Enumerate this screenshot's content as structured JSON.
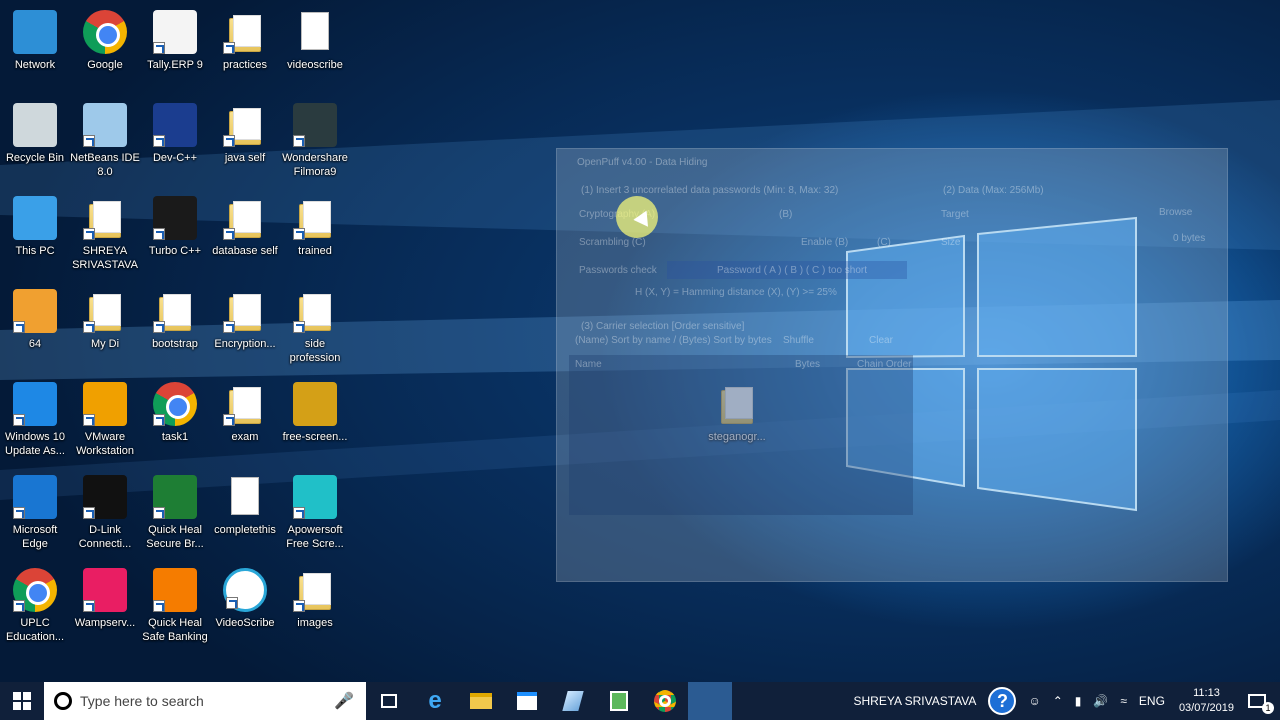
{
  "desktop": {
    "icons": [
      {
        "label": "Network",
        "type": "network"
      },
      {
        "label": "Google",
        "type": "chrome"
      },
      {
        "label": "Tally.ERP 9",
        "type": "tally"
      },
      {
        "label": "practices",
        "type": "folder"
      },
      {
        "label": "videoscribe",
        "type": "doc"
      },
      {
        "label": "Recycle Bin",
        "type": "bin"
      },
      {
        "label": "NetBeans IDE 8.0",
        "type": "netbeans"
      },
      {
        "label": "Dev-C++",
        "type": "devcpp"
      },
      {
        "label": "java self",
        "type": "folder"
      },
      {
        "label": "Wondershare Filmora9",
        "type": "filmora"
      },
      {
        "label": "This PC",
        "type": "pc"
      },
      {
        "label": "SHREYA SRIVASTAVA",
        "type": "folder"
      },
      {
        "label": "Turbo C++",
        "type": "turbo"
      },
      {
        "label": "database self",
        "type": "folder"
      },
      {
        "label": "trained",
        "type": "folder"
      },
      {
        "label": "64",
        "type": "app"
      },
      {
        "label": "My Di",
        "type": "folder"
      },
      {
        "label": "bootstrap",
        "type": "folder"
      },
      {
        "label": "Encryption...",
        "type": "folder"
      },
      {
        "label": "side profession",
        "type": "folder"
      },
      {
        "label": "Windows 10 Update As...",
        "type": "win10"
      },
      {
        "label": "VMware Workstation",
        "type": "vmware"
      },
      {
        "label": "task1",
        "type": "chrome"
      },
      {
        "label": "exam",
        "type": "folder"
      },
      {
        "label": "free-screen...",
        "type": "box"
      },
      {
        "label": "Microsoft Edge",
        "type": "edge"
      },
      {
        "label": "D-Link Connecti...",
        "type": "dlink"
      },
      {
        "label": "Quick Heal Secure Br...",
        "type": "quickheal"
      },
      {
        "label": "completethis",
        "type": "doc"
      },
      {
        "label": "Apowersoft Free Scre...",
        "type": "apower"
      },
      {
        "label": "UPLC Education...",
        "type": "chrome"
      },
      {
        "label": "Wampserv...",
        "type": "wamp"
      },
      {
        "label": "Quick Heal Safe Banking",
        "type": "qhbank"
      },
      {
        "label": "VideoScribe",
        "type": "videoscribe"
      },
      {
        "label": "images",
        "type": "folder"
      }
    ],
    "floating_icon": {
      "label": "steganogr..."
    }
  },
  "ghost_window": {
    "title": "OpenPuff v4.00 - Data Hiding",
    "section1": "(1) Insert 3 uncorrelated data passwords (Min: 8, Max: 32)",
    "cryptography": "Cryptography (A)",
    "b": "(B)",
    "scrambling": "Scrambling (C)",
    "enable": "Enable (B)",
    "c": "(C)",
    "pw_check": "Passwords check",
    "pw_msg": "Password ( A ) ( B ) ( C ) too short",
    "hamming": "H (X, Y) = Hamming distance (X), (Y) >= 25%",
    "section2": "(2) Data (Max: 256Mb)",
    "target": "Target",
    "browse": "Browse",
    "size": "Size",
    "bytes": "0 bytes",
    "section3": "(3) Carrier selection [Order sensitive]",
    "sort": "(Name) Sort by name / (Bytes) Sort by bytes",
    "shuffle": "Shuffle",
    "clear": "Clear",
    "col_name": "Name",
    "col_bytes": "Bytes",
    "col_chain": "Chain Order"
  },
  "taskbar": {
    "search_placeholder": "Type here to search",
    "user": "SHREYA SRIVASTAVA",
    "lang": "ENG",
    "time": "11:13",
    "date": "03/07/2019",
    "notifications": "1"
  }
}
